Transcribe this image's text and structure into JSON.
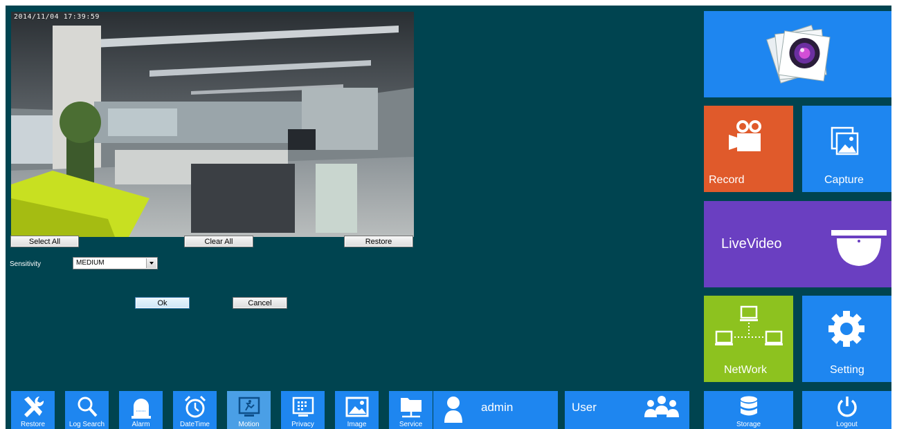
{
  "preview": {
    "timestamp": "2014/11/04 17:39:59"
  },
  "motion_area": {
    "select_all_label": "Select All",
    "clear_all_label": "Clear All",
    "restore_label": "Restore"
  },
  "sensitivity": {
    "label": "Sensitivity",
    "value": "MEDIUM"
  },
  "dialog": {
    "ok_label": "Ok",
    "cancel_label": "Cancel"
  },
  "tiles": {
    "record": "Record",
    "capture": "Capture",
    "live_video": "LiveVideo",
    "network": "NetWork",
    "setting": "Setting",
    "storage": "Storage",
    "logout": "Logout"
  },
  "bottom_bar": {
    "items": [
      {
        "label": "Restore",
        "icon": "tools-icon"
      },
      {
        "label": "Log Search",
        "icon": "search-icon"
      },
      {
        "label": "Alarm",
        "icon": "alarm-icon"
      },
      {
        "label": "DateTime",
        "icon": "clock-icon"
      },
      {
        "label": "Motion",
        "icon": "motion-icon"
      },
      {
        "label": "Privacy",
        "icon": "privacy-icon"
      },
      {
        "label": "Image",
        "icon": "image-icon"
      },
      {
        "label": "Service",
        "icon": "service-icon"
      }
    ],
    "user_name": "admin",
    "user_group": "User"
  },
  "colors": {
    "background": "#004450",
    "tile_blue": "#1e86f0",
    "tile_orange": "#e05a2b",
    "tile_purple": "#6a3fc1",
    "tile_green": "#8dc21f"
  }
}
